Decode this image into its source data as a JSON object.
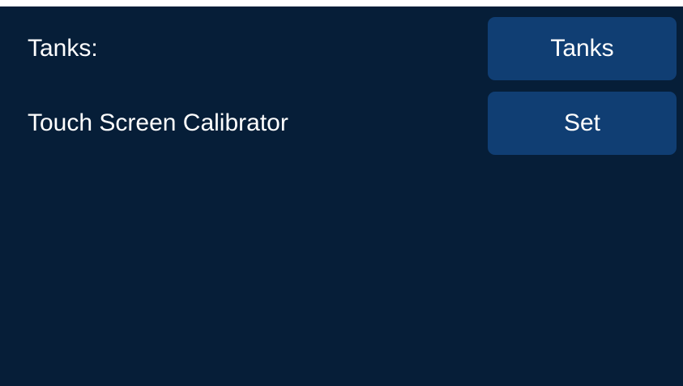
{
  "settings": {
    "rows": [
      {
        "label": "Tanks:",
        "button_label": "Tanks"
      },
      {
        "label": "Touch Screen Calibrator",
        "button_label": "Set"
      }
    ]
  },
  "colors": {
    "background": "#061e38",
    "button": "#103e73",
    "text": "#ffffff"
  }
}
